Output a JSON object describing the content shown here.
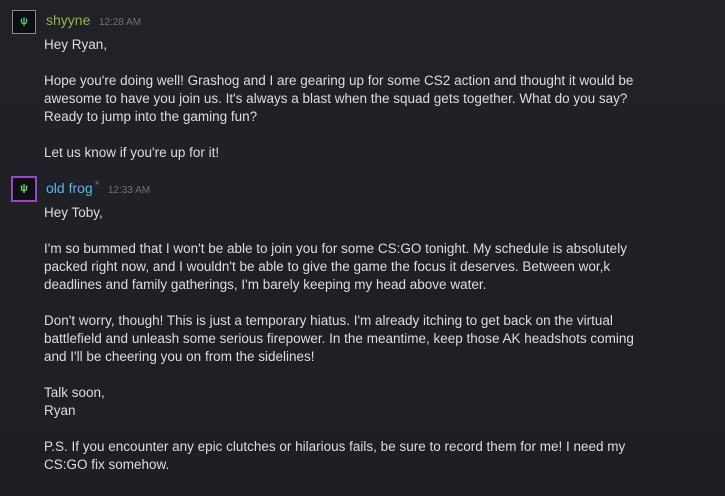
{
  "messages": [
    {
      "author": "shyyne",
      "time": "12:28 AM",
      "avatar_icon": "green-logo-icon",
      "paragraphs": [
        "Hey Ryan,",
        "Hope you're doing well! Grashog and I are gearing up for some CS2 action and thought it would be\nawesome to have you join us. It's always a blast when the squad gets together. What do you say?\nReady to jump into the gaming fun?",
        "Let us know if you're up for it!"
      ]
    },
    {
      "author": "old frog",
      "star": "*",
      "time": "12:33 AM",
      "avatar_icon": "green-logo-icon",
      "paragraphs": [
        "Hey Toby,",
        "I'm so bummed that I won't be able to join you for some CS:GO tonight. My schedule is absolutely\npacked right now, and I wouldn't be able to give the game the focus it deserves. Between wor,k\ndeadlines and family gatherings, I'm barely keeping my head above water.",
        "Don't worry, though! This is just a temporary hiatus. I'm already itching to get back on the virtual\nbattlefield and unleash some serious firepower. In the meantime, keep those AK headshots coming\nand I'll be cheering you on from the sidelines!",
        "Talk soon,\nRyan",
        "P.S. If you encounter any epic clutches or hilarious fails, be sure to record them for me! I need my\nCS:GO fix somehow."
      ]
    }
  ],
  "colors": {
    "background": "#1e2024",
    "shyyne_name": "#8fba3e",
    "frog_name": "#56b7e8",
    "frog_avatar_border": "#9a46c8",
    "text": "#dadde1",
    "timestamp": "#6f737a"
  }
}
